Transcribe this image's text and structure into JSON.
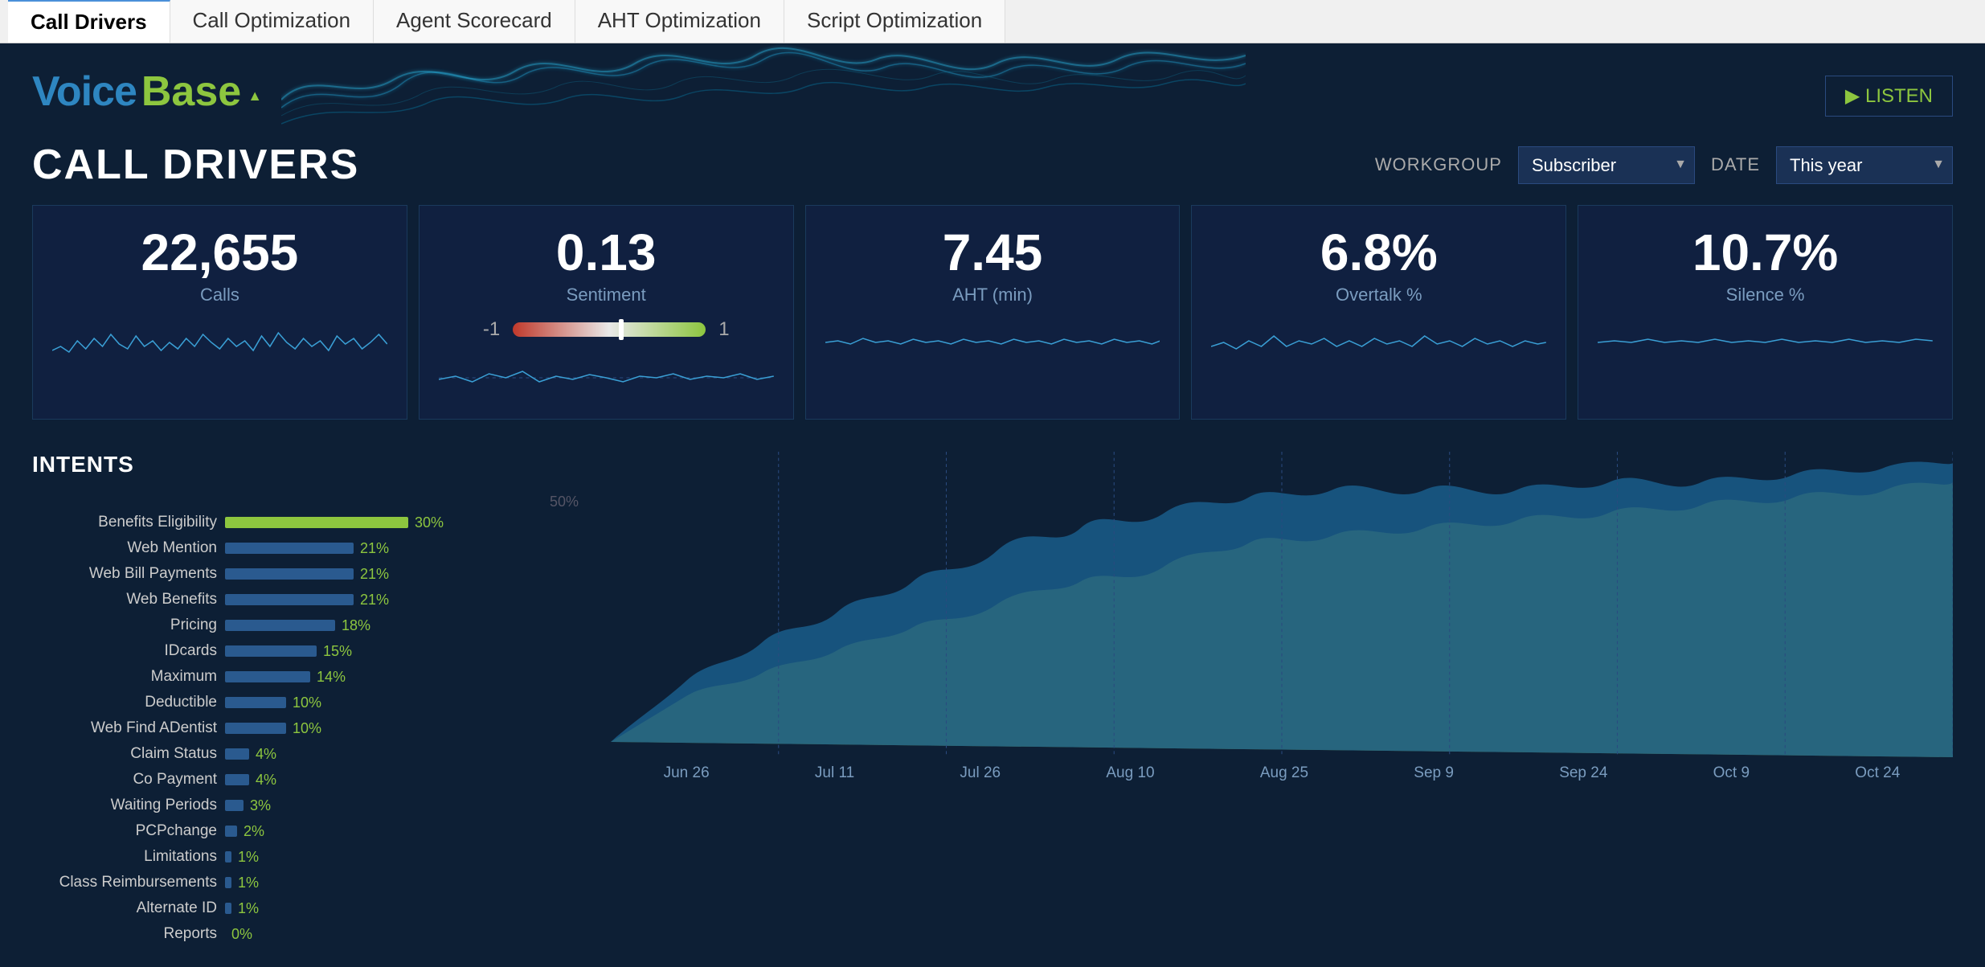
{
  "tabs": [
    {
      "label": "Call Drivers",
      "active": true
    },
    {
      "label": "Call Optimization",
      "active": false
    },
    {
      "label": "Agent Scorecard",
      "active": false
    },
    {
      "label": "AHT Optimization",
      "active": false
    },
    {
      "label": "Script Optimization",
      "active": false
    }
  ],
  "logo": {
    "voice": "Voice",
    "base": "Base",
    "triangle": "▲"
  },
  "listen_button": "▶ LISTEN",
  "page_title": "CALL DRIVERS",
  "workgroup_label": "WORKGROUP",
  "date_label": "DATE",
  "workgroup_value": "Subscriber",
  "date_value": "This year",
  "metrics": [
    {
      "value": "22,655",
      "label": "Calls",
      "type": "sparkline"
    },
    {
      "value": "0.13",
      "label": "Sentiment",
      "type": "sentiment",
      "range_min": "-1",
      "range_max": "1"
    },
    {
      "value": "7.45",
      "label": "AHT (min)",
      "type": "sparkline"
    },
    {
      "value": "6.8%",
      "label": "Overtalk %",
      "type": "sparkline"
    },
    {
      "value": "10.7%",
      "label": "Silence %",
      "type": "sparkline"
    }
  ],
  "intents_title": "INTENTS",
  "intents": [
    {
      "name": "Benefits Eligibility",
      "pct": 30,
      "label": "30%",
      "highlight": true
    },
    {
      "name": "Web Mention",
      "pct": 21,
      "label": "21%",
      "highlight": false
    },
    {
      "name": "Web Bill Payments",
      "pct": 21,
      "label": "21%",
      "highlight": false
    },
    {
      "name": "Web Benefits",
      "pct": 21,
      "label": "21%",
      "highlight": false
    },
    {
      "name": "Pricing",
      "pct": 18,
      "label": "18%",
      "highlight": false
    },
    {
      "name": "IDcards",
      "pct": 15,
      "label": "15%",
      "highlight": false
    },
    {
      "name": "Maximum",
      "pct": 14,
      "label": "14%",
      "highlight": false
    },
    {
      "name": "Deductible",
      "pct": 10,
      "label": "10%",
      "highlight": false
    },
    {
      "name": "Web Find ADentist",
      "pct": 10,
      "label": "10%",
      "highlight": false
    },
    {
      "name": "Claim Status",
      "pct": 4,
      "label": "4%",
      "highlight": false
    },
    {
      "name": "Co Payment",
      "pct": 4,
      "label": "4%",
      "highlight": false
    },
    {
      "name": "Waiting Periods",
      "pct": 3,
      "label": "3%",
      "highlight": false
    },
    {
      "name": "PCPchange",
      "pct": 2,
      "label": "2%",
      "highlight": false
    },
    {
      "name": "Limitations",
      "pct": 1,
      "label": "1%",
      "highlight": false
    },
    {
      "name": "Class Reimbursements",
      "pct": 1,
      "label": "1%",
      "highlight": false
    },
    {
      "name": "Alternate ID",
      "pct": 1,
      "label": "1%",
      "highlight": false
    },
    {
      "name": "Reports",
      "pct": 0,
      "label": "0%",
      "highlight": false
    }
  ],
  "pct_axis_label": "50%",
  "chart_x_labels": [
    "Jun 26",
    "Jul 11",
    "Jul 26",
    "Aug 10",
    "Aug 25",
    "Sep 9",
    "Sep 24",
    "Oct 9",
    "Oct 24"
  ]
}
